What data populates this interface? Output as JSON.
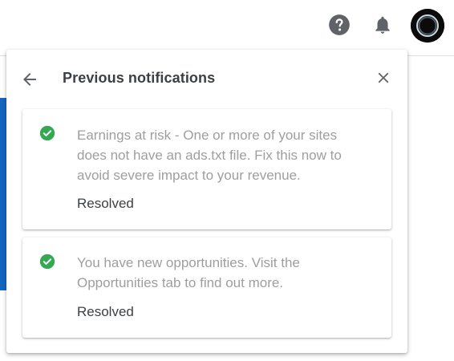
{
  "topbar": {
    "help_icon": "help-circle-icon",
    "bell_icon": "bell-icon",
    "avatar_icon": "account-avatar"
  },
  "panel": {
    "title": "Previous notifications",
    "back_icon": "arrow-left-icon",
    "close_icon": "close-icon"
  },
  "notifications": [
    {
      "icon": "check-circle-icon",
      "text": "Earnings at risk - One or more of your sites does not have an ads.txt file. Fix this now to avoid severe impact to your revenue.",
      "status": "Resolved"
    },
    {
      "icon": "check-circle-icon",
      "text": "You have new opportunities. Visit the Opportunities tab to find out more.",
      "status": "Resolved"
    }
  ],
  "colors": {
    "accent_blue": "#1565c0",
    "check_green": "#34a853",
    "icon_gray": "#5f6368"
  }
}
